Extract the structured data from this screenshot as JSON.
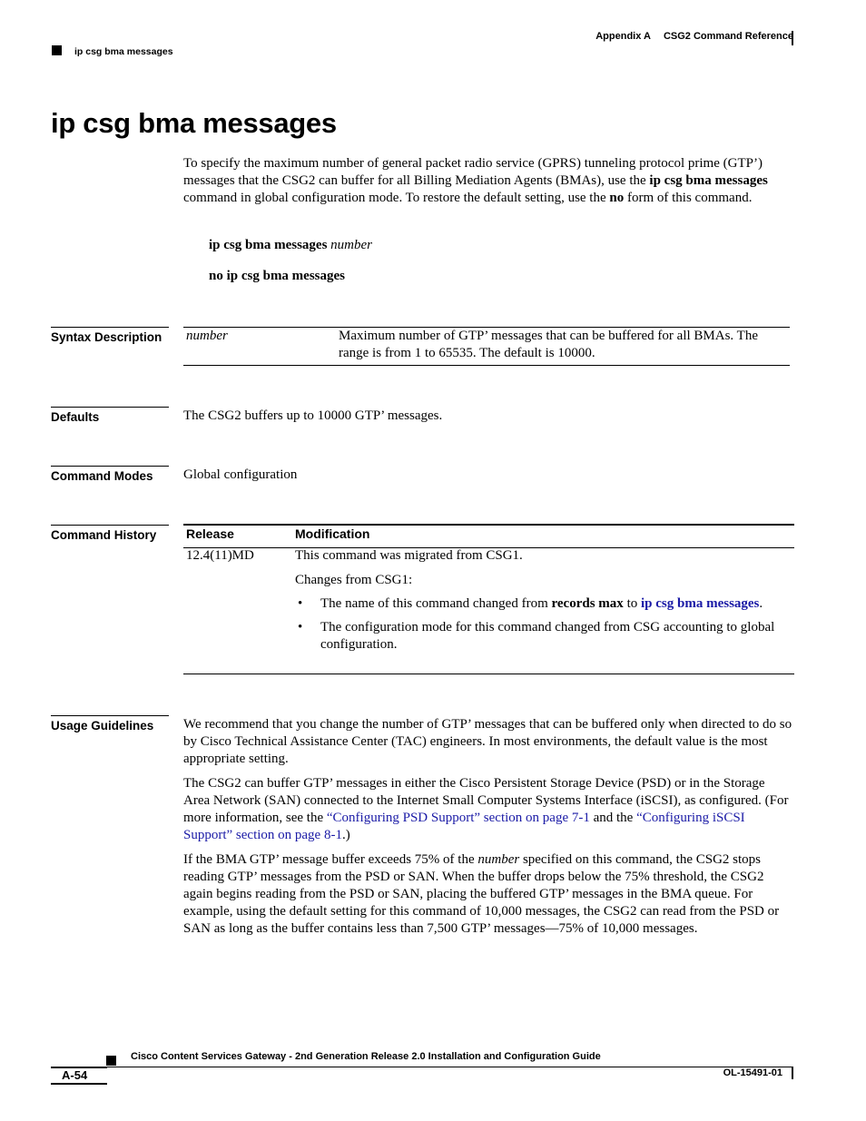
{
  "header": {
    "appendix": "Appendix A",
    "chapter": "CSG2 Command Reference",
    "running_head": "ip csg bma messages"
  },
  "title": "ip csg bma messages",
  "intro": {
    "part1": "To specify the maximum number of general packet radio service (GPRS) tunneling protocol prime (GTP’) messages that the CSG2 can buffer for all Billing Mediation Agents (BMAs), use the ",
    "cmd_bold": "ip csg bma messages",
    "part2": " command in global configuration mode. To restore the default setting, use the ",
    "no_bold": "no",
    "part3": " form of this command."
  },
  "syntax": {
    "line1_cmd": "ip csg bma messages",
    "line1_arg": "number",
    "line2_cmd": "no ip csg bma messages"
  },
  "sections": {
    "syntax_description": "Syntax Description",
    "defaults": "Defaults",
    "command_modes": "Command Modes",
    "command_history": "Command History",
    "usage_guidelines": "Usage Guidelines"
  },
  "syntax_description": {
    "param": "number",
    "desc": "Maximum number of GTP’ messages that can be buffered for all BMAs. The range is from 1 to 65535. The default is 10000."
  },
  "defaults_text": "The CSG2 buffers up to 10000 GTP’ messages.",
  "command_modes_text": "Global configuration",
  "command_history": {
    "col_release": "Release",
    "col_modification": "Modification",
    "rows": [
      {
        "release": "12.4(11)MD",
        "line1": "This command was migrated from CSG1.",
        "line2": "Changes from CSG1:",
        "bullet1_pre": "The name of this command changed from ",
        "bullet1_bold": "records max",
        "bullet1_mid": " to ",
        "bullet1_link": "ip csg bma messages",
        "bullet1_post": ".",
        "bullet2": "The configuration mode for this command changed from CSG accounting to global configuration."
      }
    ]
  },
  "usage": {
    "p1": "We recommend that you change the number of GTP’ messages that can be buffered only when directed to do so by Cisco Technical Assistance Center (TAC) engineers. In most environments, the default value is the most appropriate setting.",
    "p2_pre": "The CSG2 can buffer GTP’ messages in either the Cisco Persistent Storage Device (PSD) or in the Storage Area Network (SAN) connected to the Internet Small Computer Systems Interface (iSCSI), as configured. (For more information, see the ",
    "p2_link1": "“Configuring PSD Support” section on page 7-1",
    "p2_mid": " and the ",
    "p2_link2": "“Configuring iSCSI Support” section on page 8-1",
    "p2_post": ".)",
    "p3_pre": "If the BMA GTP’ message buffer exceeds 75% of the ",
    "p3_italic": "number",
    "p3_post": " specified on this command, the CSG2 stops reading GTP’ messages from the PSD or SAN. When the buffer drops below the 75% threshold, the CSG2 again begins reading from the PSD or SAN, placing the buffered GTP’ messages in the BMA queue. For example, using the default setting for this command of 10,000 messages, the CSG2 can read from the PSD or SAN as long as the buffer contains less than 7,500 GTP’ messages—75% of 10,000 messages."
  },
  "footer": {
    "guide_title": "Cisco Content Services Gateway - 2nd Generation Release 2.0 Installation and Configuration Guide",
    "page_number": "A-54",
    "doc_number": "OL-15491-01"
  },
  "colors": {
    "link": "#1a1aa6",
    "text": "#000000"
  }
}
